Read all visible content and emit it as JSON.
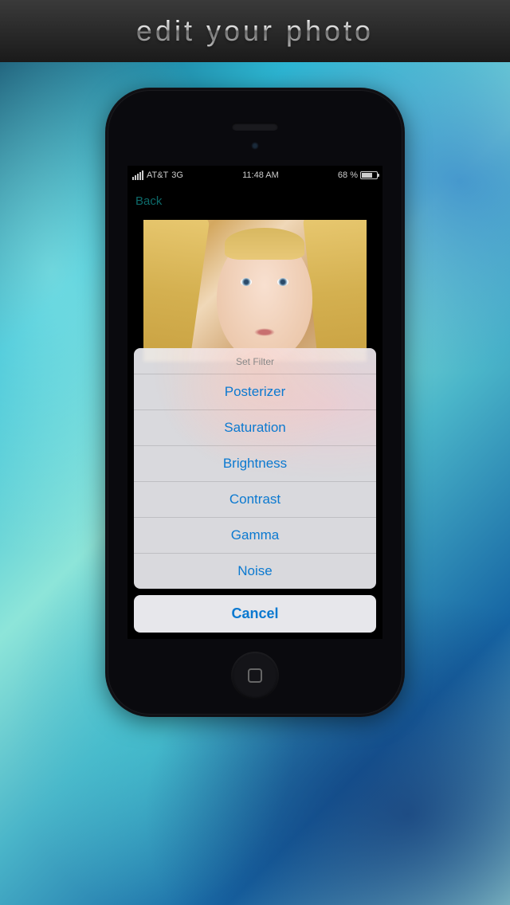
{
  "header": {
    "title": "edit your photo"
  },
  "status": {
    "carrier": "AT&T",
    "network": "3G",
    "time": "11:48 AM",
    "battery_pct": "68 %"
  },
  "nav": {
    "back": "Back"
  },
  "sheet": {
    "title": "Set Filter",
    "items": [
      "Posterizer",
      "Saturation",
      "Brightness",
      "Contrast",
      "Gamma",
      "Noise"
    ],
    "cancel": "Cancel"
  }
}
